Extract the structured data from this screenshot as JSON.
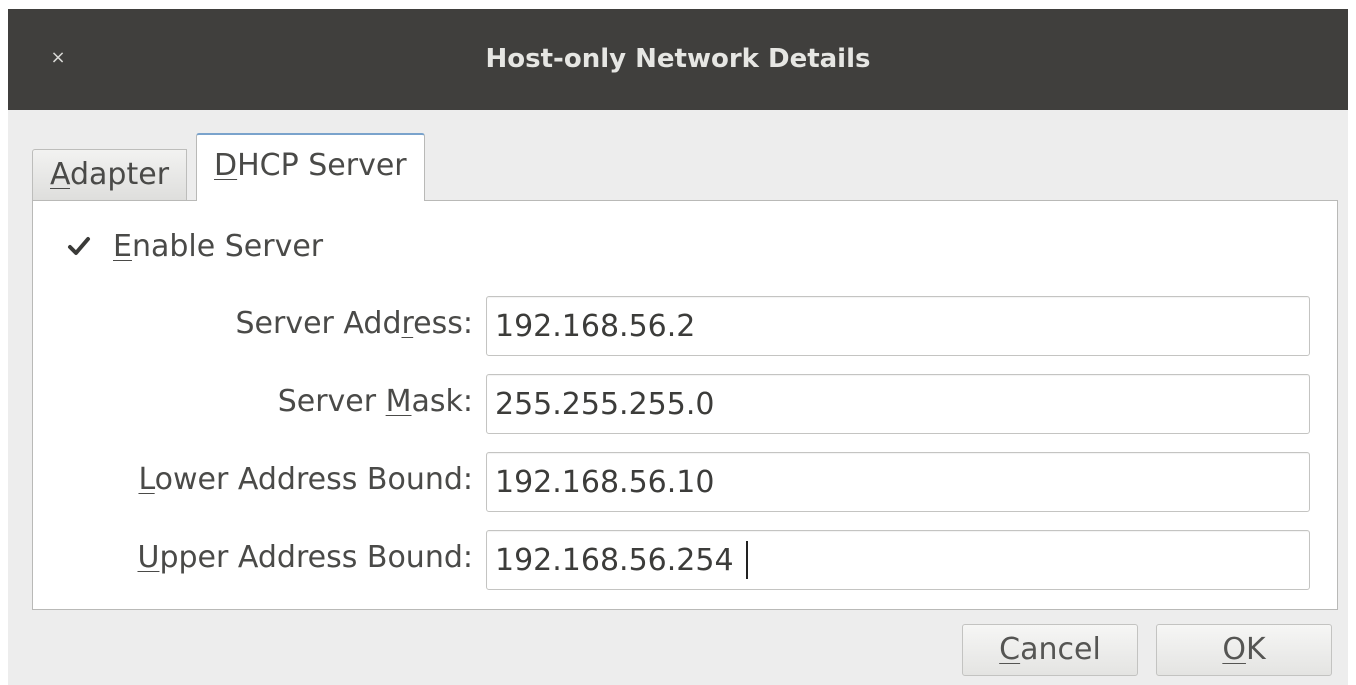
{
  "window": {
    "title": "Host-only Network Details",
    "close_glyph": "×"
  },
  "tabs": [
    {
      "label_first": "A",
      "label_rest": "dapter",
      "selected": false
    },
    {
      "label_first": "D",
      "label_rest": "HCP Server",
      "selected": true
    }
  ],
  "dhcp": {
    "enable_server": {
      "checked": true,
      "label_first": "E",
      "label_rest": "nable Server"
    },
    "fields": [
      {
        "label_pre": "Server Add",
        "label_mnemonic": "r",
        "label_post": "ess:",
        "value": "192.168.56.2"
      },
      {
        "label_pre": "Server ",
        "label_mnemonic": "M",
        "label_post": "ask:",
        "value": "255.255.255.0"
      },
      {
        "label_pre": "",
        "label_mnemonic": "L",
        "label_post": "ower Address Bound:",
        "value": "192.168.56.10"
      },
      {
        "label_pre": "",
        "label_mnemonic": "U",
        "label_post": "pper Address Bound:",
        "value": "192.168.56.254"
      }
    ]
  },
  "buttons": {
    "cancel_first": "C",
    "cancel_rest": "ancel",
    "ok_first": "O",
    "ok_rest": "K"
  },
  "icons": {
    "close": "close-icon",
    "checkbox": "checkmark-icon"
  }
}
